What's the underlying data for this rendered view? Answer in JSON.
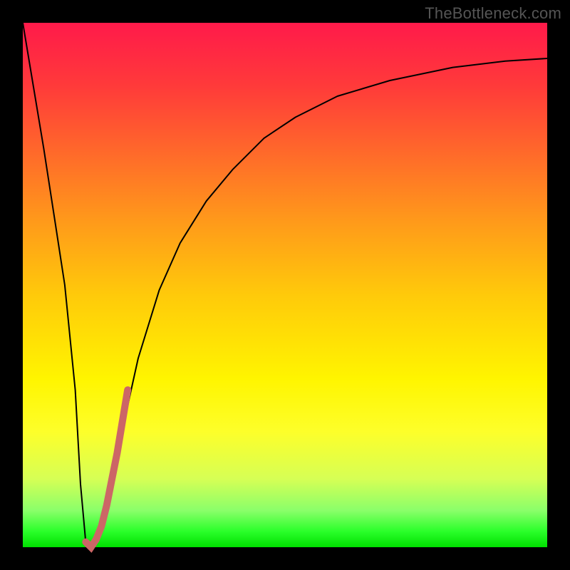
{
  "watermark": "TheBottleneck.com",
  "chart_data": {
    "type": "line",
    "title": "",
    "xlabel": "",
    "ylabel": "",
    "xlim": [
      0,
      100
    ],
    "ylim": [
      0,
      100
    ],
    "grid": false,
    "legend": false,
    "background_gradient": {
      "orientation": "vertical",
      "stops": [
        {
          "pos": 0.0,
          "color": "#ff1a4a"
        },
        {
          "pos": 0.5,
          "color": "#ffca0a"
        },
        {
          "pos": 0.78,
          "color": "#fdff2a"
        },
        {
          "pos": 1.0,
          "color": "#00e000"
        }
      ]
    },
    "series": [
      {
        "name": "bottleneck-curve",
        "color": "#000000",
        "width": 2,
        "x": [
          0,
          2,
          4,
          6,
          8,
          10,
          11,
          12,
          13,
          15,
          18,
          22,
          26,
          30,
          35,
          40,
          46,
          52,
          60,
          70,
          82,
          92,
          100
        ],
        "y": [
          100,
          88,
          76,
          63,
          50,
          30,
          12,
          1,
          0,
          4,
          18,
          36,
          49,
          58,
          66,
          72,
          78,
          82,
          86,
          89,
          91.5,
          92.7,
          93.2
        ]
      },
      {
        "name": "highlight-segment",
        "color": "#cc6666",
        "width": 10,
        "x": [
          12,
          13,
          14,
          15,
          16,
          17,
          18,
          19,
          20
        ],
        "y": [
          1,
          0,
          1.5,
          4,
          8,
          13,
          18,
          24,
          30
        ]
      }
    ]
  }
}
